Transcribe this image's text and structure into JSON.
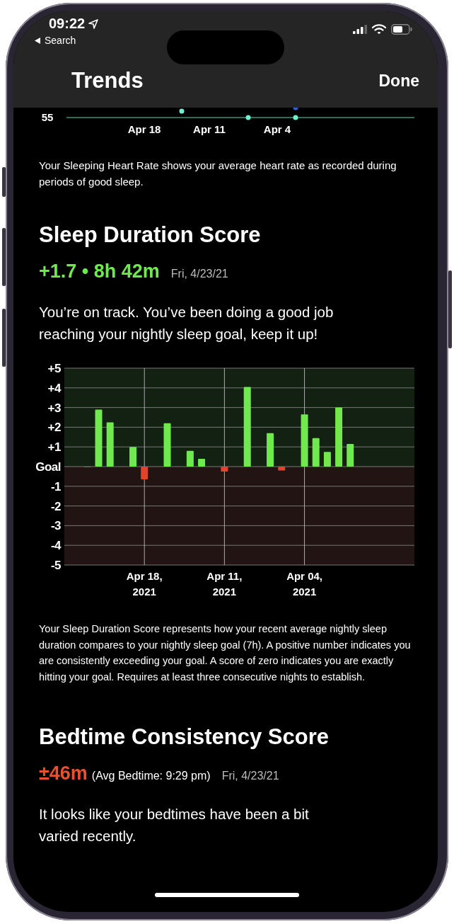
{
  "status_bar": {
    "time": "09:22",
    "back_label": "Search"
  },
  "nav": {
    "title": "Trends",
    "done": "Done"
  },
  "heart_rate_chart": {
    "y_label": "55",
    "x_labels": [
      "Apr 18",
      "Apr 11",
      "Apr 4"
    ]
  },
  "heart_rate_description": "Your Sleeping Heart Rate shows your average heart rate as recorded during periods of good sleep.",
  "sleep_duration": {
    "title": "Sleep Duration Score",
    "score": "+1.7 • 8h 42m",
    "date": "Fri, 4/23/21",
    "message": "You’re on track. You’ve been doing a good job reaching your nightly sleep goal, keep it up!",
    "chart_data": {
      "type": "bar",
      "categories": [
        null,
        null,
        null,
        null,
        null,
        null,
        null,
        "Apr 18, 2021",
        null,
        null,
        null,
        null,
        null,
        null,
        "Apr 11, 2021",
        null,
        null,
        null,
        null,
        null,
        null,
        "Apr 04, 2021",
        null,
        null,
        null,
        null,
        null,
        null,
        null,
        null,
        null
      ],
      "grid": true,
      "series": [
        {
          "color": "#6fe94d",
          "values": [
            null,
            null,
            null,
            2.9,
            2.25,
            null,
            1.0,
            null,
            null,
            2.2,
            null,
            0.8,
            0.4,
            null,
            null,
            null,
            4.05,
            null,
            1.7,
            null,
            null,
            2.65,
            1.45,
            0.75,
            3.0,
            1.15,
            null,
            null,
            null,
            null,
            null
          ]
        },
        {
          "color": "#e0452b",
          "values": [
            null,
            null,
            -0.02,
            null,
            null,
            null,
            null,
            -0.65,
            null,
            null,
            null,
            null,
            null,
            null,
            -0.25,
            null,
            null,
            null,
            null,
            -0.2,
            null,
            null,
            null,
            null,
            null,
            null,
            null,
            null,
            null,
            null,
            null
          ]
        }
      ],
      "ylim": [
        -5,
        5
      ],
      "yticks": [
        {
          "value": 5,
          "label": "+5"
        },
        {
          "value": 4,
          "label": "+4"
        },
        {
          "value": 3,
          "label": "+3"
        },
        {
          "value": 2,
          "label": "+2"
        },
        {
          "value": 1,
          "label": "+1"
        },
        {
          "value": 0,
          "label": "Goal"
        },
        {
          "value": -1,
          "label": "-1"
        },
        {
          "value": -2,
          "label": "-2"
        },
        {
          "value": -3,
          "label": "-3"
        },
        {
          "value": -4,
          "label": "-4"
        },
        {
          "value": -5,
          "label": "-5"
        }
      ]
    },
    "description": "Your Sleep Duration Score represents how your recent average nightly sleep duration compares to your nightly sleep goal (7h). A positive number indicates you are consistently exceeding your goal. A score of zero indicates you are exactly hitting your goal.  Requires at least three consecutive nights to establish."
  },
  "bedtime_consistency": {
    "title": "Bedtime Consistency Score",
    "score": "±46m",
    "detail": "(Avg Bedtime: 9:29 pm)",
    "date": "Fri, 4/23/21",
    "message": "It looks like your bedtimes have been a bit varied recently."
  }
}
